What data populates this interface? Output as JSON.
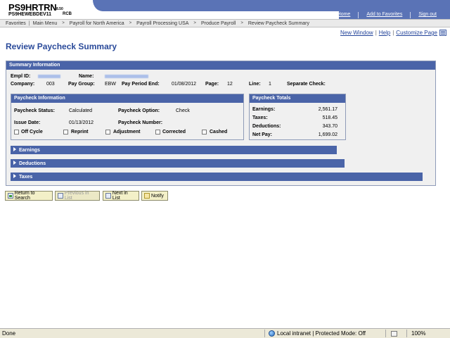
{
  "header": {
    "title": "PS9HRTRN",
    "version": "8.50",
    "database": "PS9HEWEBDEV11",
    "user": "RCB",
    "links": [
      "Home",
      "Add to Favorites",
      "Sign out"
    ]
  },
  "breadcrumb": {
    "items": [
      "Favorites",
      "Main Menu",
      "Payroll for North America",
      "Payroll Processing USA",
      "Produce Payroll",
      "Review Paycheck Summary"
    ]
  },
  "tools": {
    "new_window": "New Window",
    "help": "Help",
    "customize": "Customize Page"
  },
  "page_title": "Review Paycheck Summary",
  "summary": {
    "header": "Summary Information",
    "empl_id_label": "Empl ID:",
    "name_label": "Name:",
    "company_label": "Company:",
    "company": "003",
    "pay_group_label": "Pay Group:",
    "pay_group": "EBW",
    "pay_period_end_label": "Pay Period End:",
    "pay_period_end": "01/08/2012",
    "page_label": "Page:",
    "page": "12",
    "line_label": "Line:",
    "line": "1",
    "separate_check_label": "Separate Check:"
  },
  "paycheck_info": {
    "header": "Paycheck Information",
    "status_label": "Paycheck Status:",
    "status": "Calculated",
    "option_label": "Paycheck Option:",
    "option": "Check",
    "issue_date_label": "Issue Date:",
    "issue_date": "01/13/2012",
    "number_label": "Paycheck Number:",
    "checkboxes": [
      "Off Cycle",
      "Reprint",
      "Adjustment",
      "Corrected",
      "Cashed"
    ]
  },
  "totals": {
    "header": "Paycheck Totals",
    "earnings_label": "Earnings:",
    "earnings": "2,561.17",
    "taxes_label": "Taxes:",
    "taxes": "518.45",
    "deductions_label": "Deductions:",
    "deductions": "343.70",
    "net_pay_label": "Net Pay:",
    "net_pay": "1,699.02"
  },
  "sections": [
    "Earnings",
    "Deductions",
    "Taxes"
  ],
  "buttons": {
    "return_to_search": "Return to Search",
    "previous_in_list": "Previous in List",
    "next_in_list": "Next in List",
    "notify": "Notify"
  },
  "status_bar": {
    "state": "Done",
    "zone": "Local intranet | Protected Mode: Off",
    "zoom": "100%"
  },
  "colors": {
    "brand_blue": "#5a73b6",
    "section_blue": "#4a64a8",
    "title_blue": "#2a4a9a"
  }
}
